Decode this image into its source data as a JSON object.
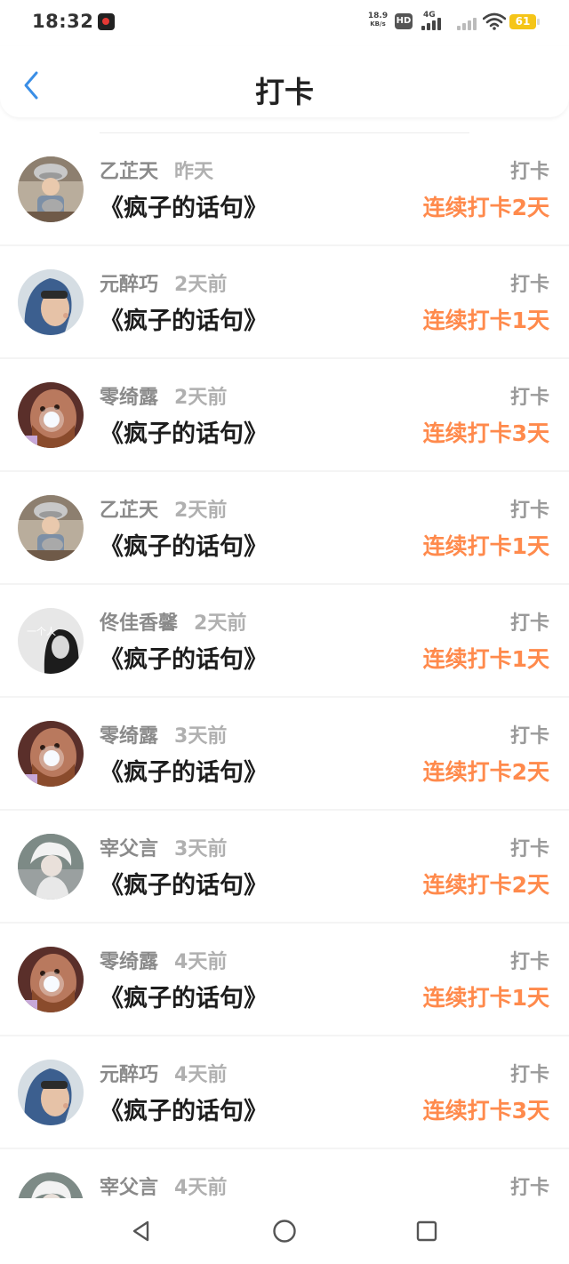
{
  "status_bar": {
    "time": "18:32",
    "net_speed_value": "18.9",
    "net_speed_unit": "KB/s",
    "hd_label": "HD",
    "network_label": "4G",
    "battery": "61",
    "icons": [
      "screen-record-icon",
      "hd-icon",
      "signal-4g-icon",
      "signal-icon",
      "wifi-icon",
      "battery-icon"
    ]
  },
  "header": {
    "title": "打卡",
    "back_icon": "chevron-left-icon",
    "accent_color": "#3a8ee6"
  },
  "colors": {
    "streak": "#ff8a4c",
    "name": "#8a8a8a",
    "time": "#b0b0b0"
  },
  "checkins": [
    {
      "user": "乙芷天",
      "time": "昨天",
      "book": "《疯子的话句》",
      "action": "打卡",
      "streak": "连续打卡2天",
      "avatar": "avatar-child-colander"
    },
    {
      "user": "元醉巧",
      "time": "2天前",
      "book": "《疯子的话句》",
      "action": "打卡",
      "streak": "连续打卡1天",
      "avatar": "avatar-hooded-kid"
    },
    {
      "user": "零绮露",
      "time": "2天前",
      "book": "《疯子的话句》",
      "action": "打卡",
      "streak": "连续打卡3天",
      "avatar": "avatar-bearded-man-light"
    },
    {
      "user": "乙芷天",
      "time": "2天前",
      "book": "《疯子的话句》",
      "action": "打卡",
      "streak": "连续打卡1天",
      "avatar": "avatar-child-colander"
    },
    {
      "user": "佟佳香馨",
      "time": "2天前",
      "book": "《疯子的话句》",
      "action": "打卡",
      "streak": "连续打卡1天",
      "avatar": "avatar-bw-girl"
    },
    {
      "user": "零绮露",
      "time": "3天前",
      "book": "《疯子的话句》",
      "action": "打卡",
      "streak": "连续打卡2天",
      "avatar": "avatar-bearded-man-light"
    },
    {
      "user": "宰父言",
      "time": "3天前",
      "book": "《疯子的话句》",
      "action": "打卡",
      "streak": "连续打卡2天",
      "avatar": "avatar-white-hair"
    },
    {
      "user": "零绮露",
      "time": "4天前",
      "book": "《疯子的话句》",
      "action": "打卡",
      "streak": "连续打卡1天",
      "avatar": "avatar-bearded-man-light"
    },
    {
      "user": "元醉巧",
      "time": "4天前",
      "book": "《疯子的话句》",
      "action": "打卡",
      "streak": "连续打卡3天",
      "avatar": "avatar-hooded-kid"
    },
    {
      "user": "宰父言",
      "time": "4天前",
      "book": "",
      "action": "打卡",
      "streak": "",
      "avatar": "avatar-white-hair"
    }
  ],
  "nav_bar": {
    "icons": [
      "back-triangle-icon",
      "home-circle-icon",
      "recents-square-icon"
    ]
  }
}
